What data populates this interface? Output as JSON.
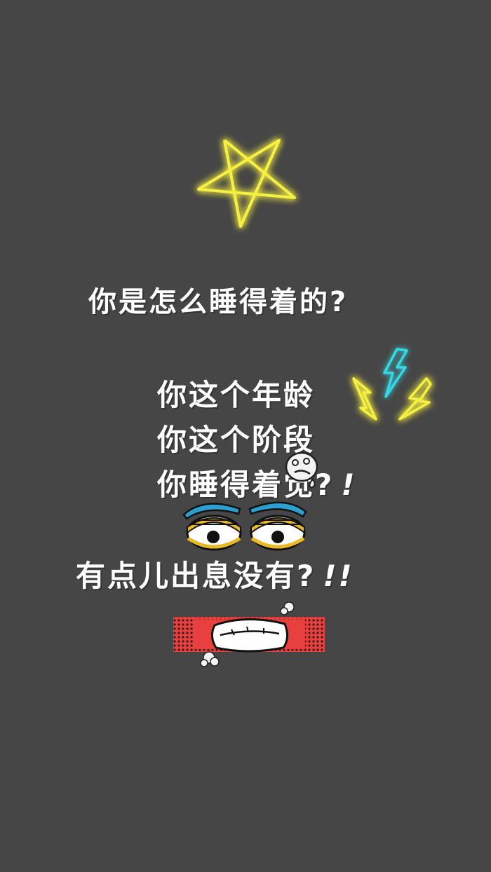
{
  "text": {
    "line1": "你是怎么睡得着的?",
    "line2": "你这个年龄",
    "line3": "你这个阶段",
    "line4": "你睡得着觉?",
    "line4_exclaim": "!",
    "line5": "有点儿出息没有?",
    "line5_exclaim": "!!"
  },
  "colors": {
    "background": "#464646",
    "neon_yellow": "#f5f042",
    "neon_cyan": "#35d9e6",
    "mouth_red": "#e8403e",
    "eye_gold": "#e9b826",
    "brow_blue": "#2a9fd0"
  },
  "icons": [
    "neon-star-icon",
    "lightning-bolts-icon",
    "angry-eyes-icon",
    "sweat-face-sticker",
    "angry-mouth-icon"
  ]
}
